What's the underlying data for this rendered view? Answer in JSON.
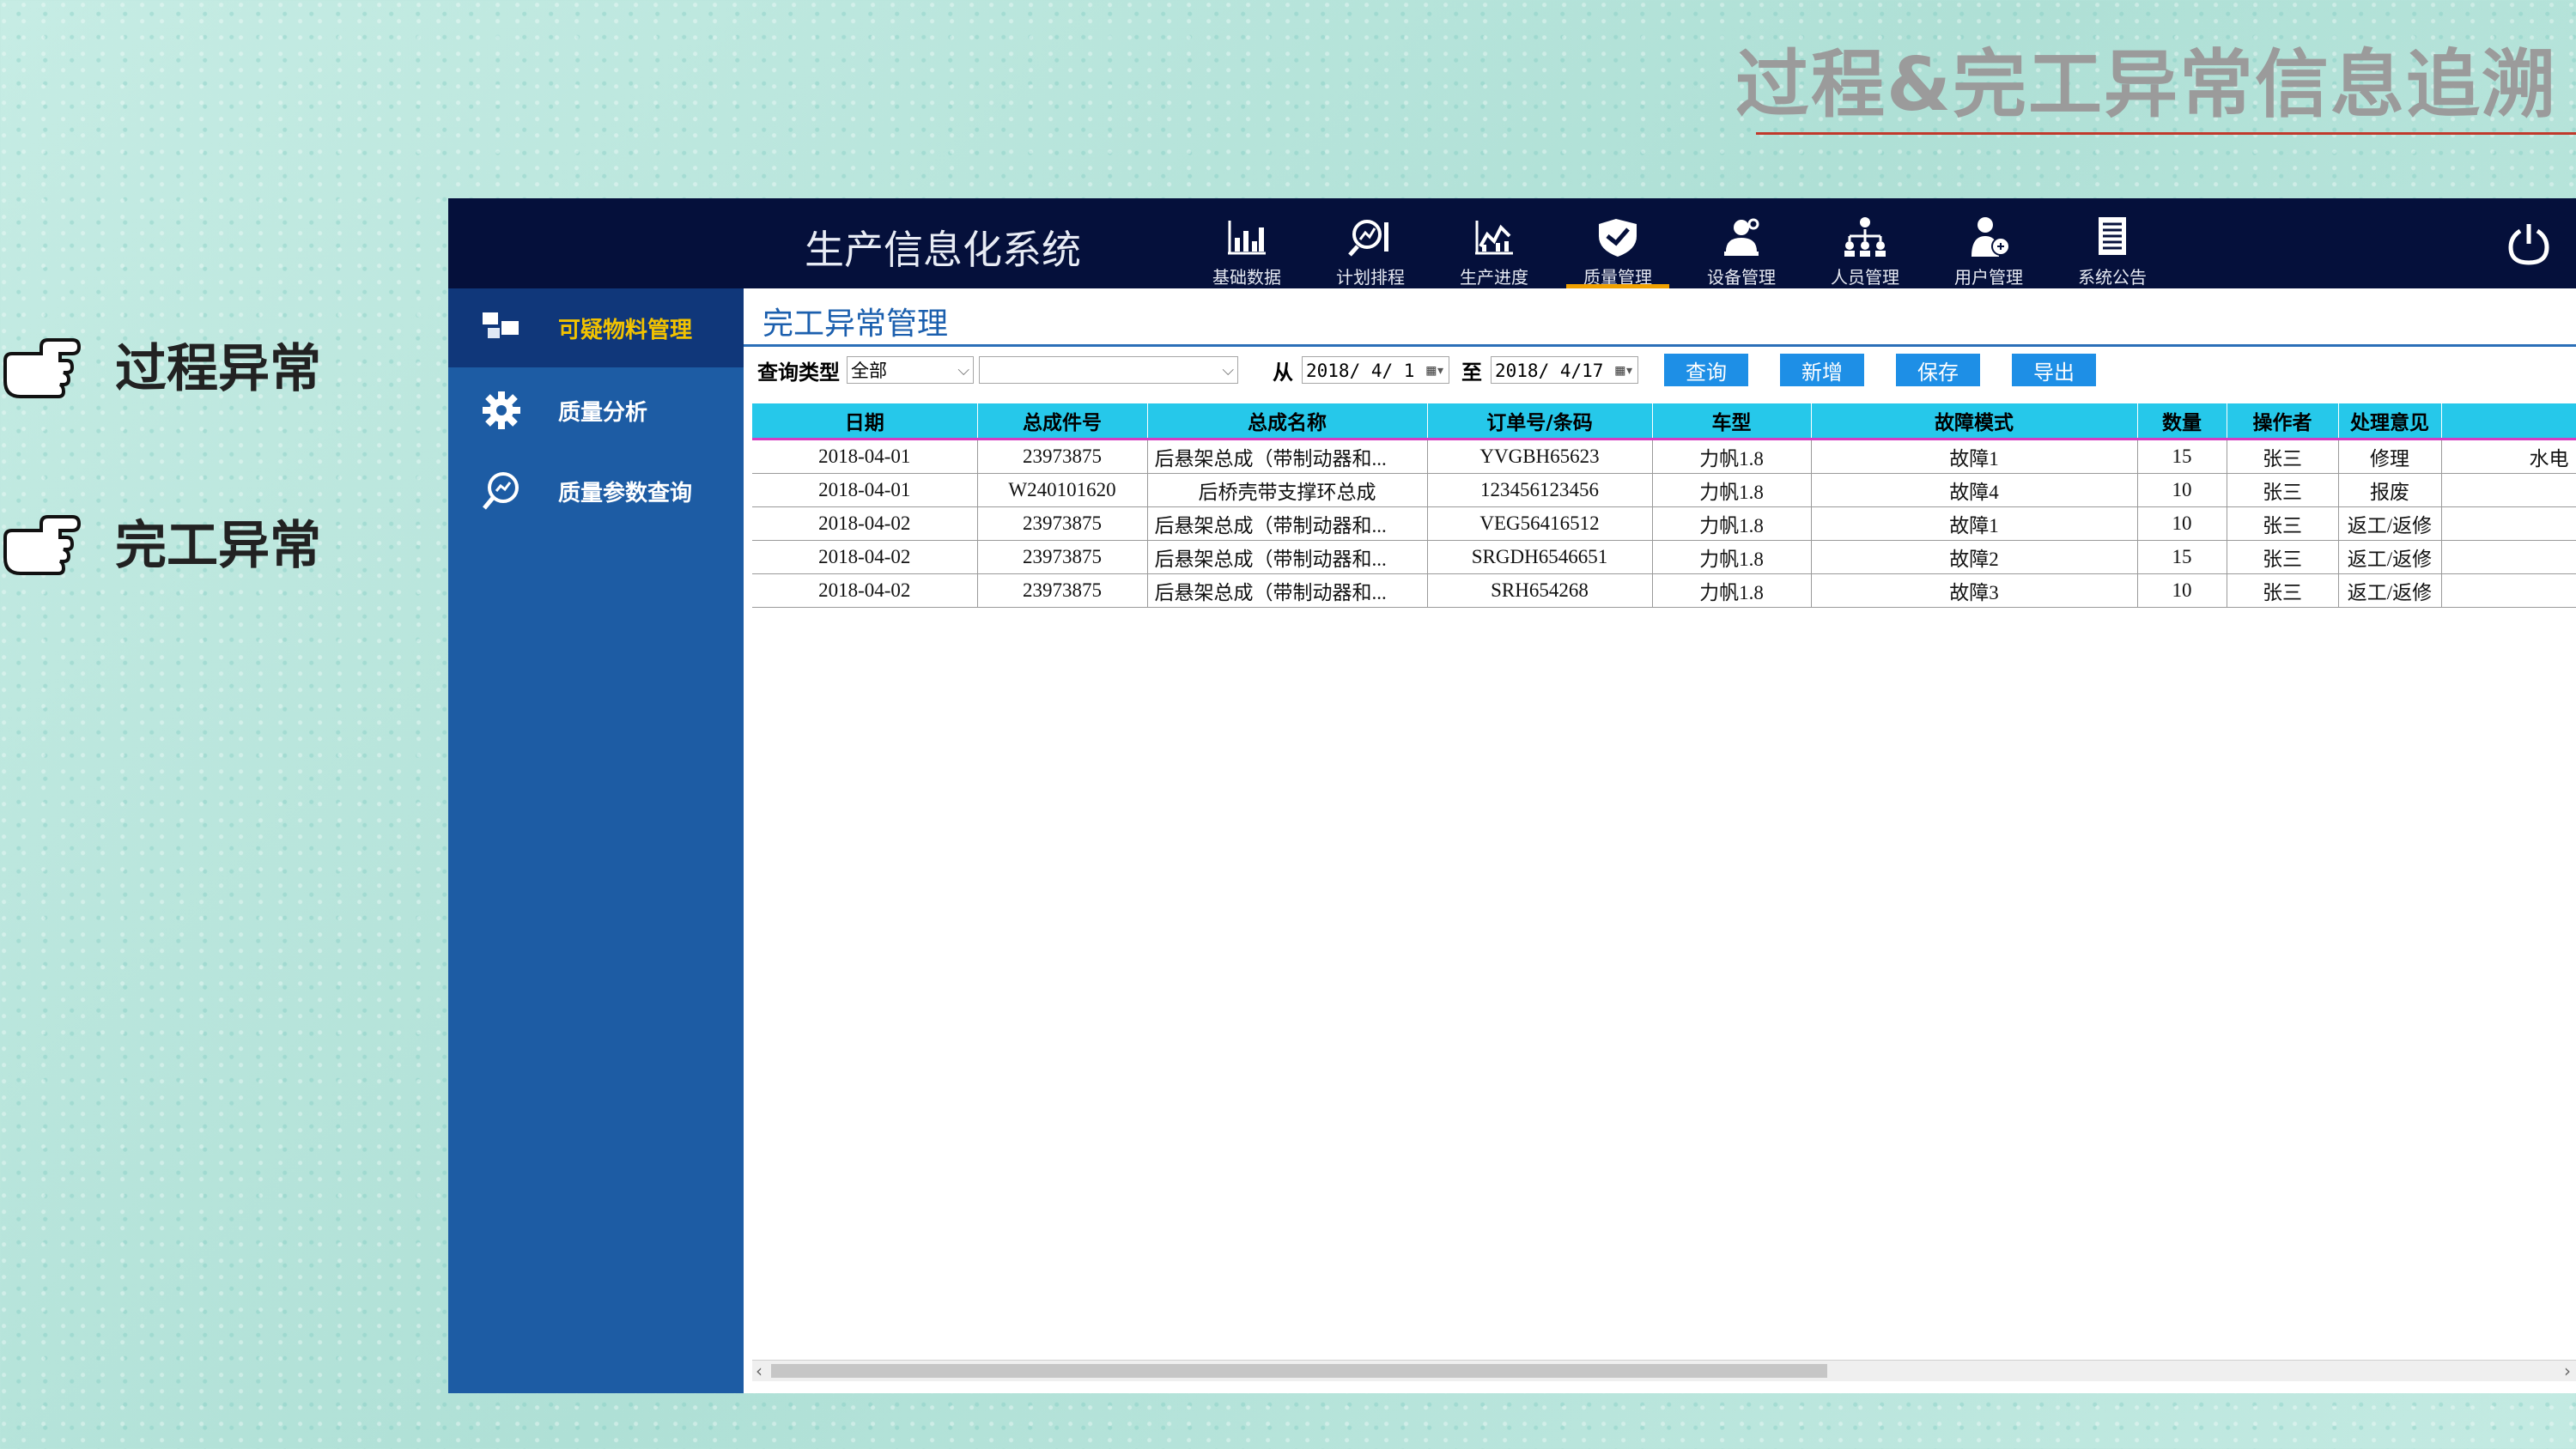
{
  "slide": {
    "title": "过程&完工异常信息追溯",
    "bullets": [
      "过程异常",
      "完工异常"
    ]
  },
  "app": {
    "system_title": "生产信息化系统",
    "nav": [
      {
        "label": "基础数据",
        "icon": "bar-chart-icon"
      },
      {
        "label": "计划排程",
        "icon": "search-chart-icon"
      },
      {
        "label": "生产进度",
        "icon": "line-chart-icon"
      },
      {
        "label": "质量管理",
        "icon": "quality-shield-icon",
        "active": true
      },
      {
        "label": "设备管理",
        "icon": "equipment-user-icon"
      },
      {
        "label": "人员管理",
        "icon": "org-chart-icon"
      },
      {
        "label": "用户管理",
        "icon": "user-icon"
      },
      {
        "label": "系统公告",
        "icon": "document-icon"
      }
    ],
    "sidebar": [
      {
        "label": "可疑物料管理",
        "icon": "boxes-icon",
        "active": true
      },
      {
        "label": "质量分析",
        "icon": "gear-icon"
      },
      {
        "label": "质量参数查询",
        "icon": "search-icon"
      }
    ],
    "page_title": "完工异常管理",
    "toolbar": {
      "query_type_label": "查询类型",
      "query_type_value": "全部",
      "second_select_value": "",
      "from_label": "从",
      "from_date": "2018/ 4/ 1",
      "to_label": "至",
      "to_date": "2018/ 4/17",
      "buttons": [
        "查询",
        "新增",
        "保存",
        "导出"
      ]
    },
    "table": {
      "columns": [
        "日期",
        "总成件号",
        "总成名称",
        "订单号/条码",
        "车型",
        "故障模式",
        "数量",
        "操作者",
        "处理意见",
        ""
      ],
      "rows": [
        [
          "2018-04-01",
          "23973875",
          "后悬架总成（带制动器和...",
          "YVGBH65623",
          "力帆1.8",
          "故障1",
          "15",
          "张三",
          "修理",
          "水电"
        ],
        [
          "2018-04-01",
          "W240101620",
          "后桥壳带支撑环总成",
          "123456123456",
          "力帆1.8",
          "故障4",
          "10",
          "张三",
          "报废",
          ""
        ],
        [
          "2018-04-02",
          "23973875",
          "后悬架总成（带制动器和...",
          "VEG56416512",
          "力帆1.8",
          "故障1",
          "10",
          "张三",
          "返工/返修",
          ""
        ],
        [
          "2018-04-02",
          "23973875",
          "后悬架总成（带制动器和...",
          "SRGDH6546651",
          "力帆1.8",
          "故障2",
          "15",
          "张三",
          "返工/返修",
          ""
        ],
        [
          "2018-04-02",
          "23973875",
          "后悬架总成（带制动器和...",
          "SRH654268",
          "力帆1.8",
          "故障3",
          "10",
          "张三",
          "返工/返修",
          ""
        ]
      ]
    }
  }
}
